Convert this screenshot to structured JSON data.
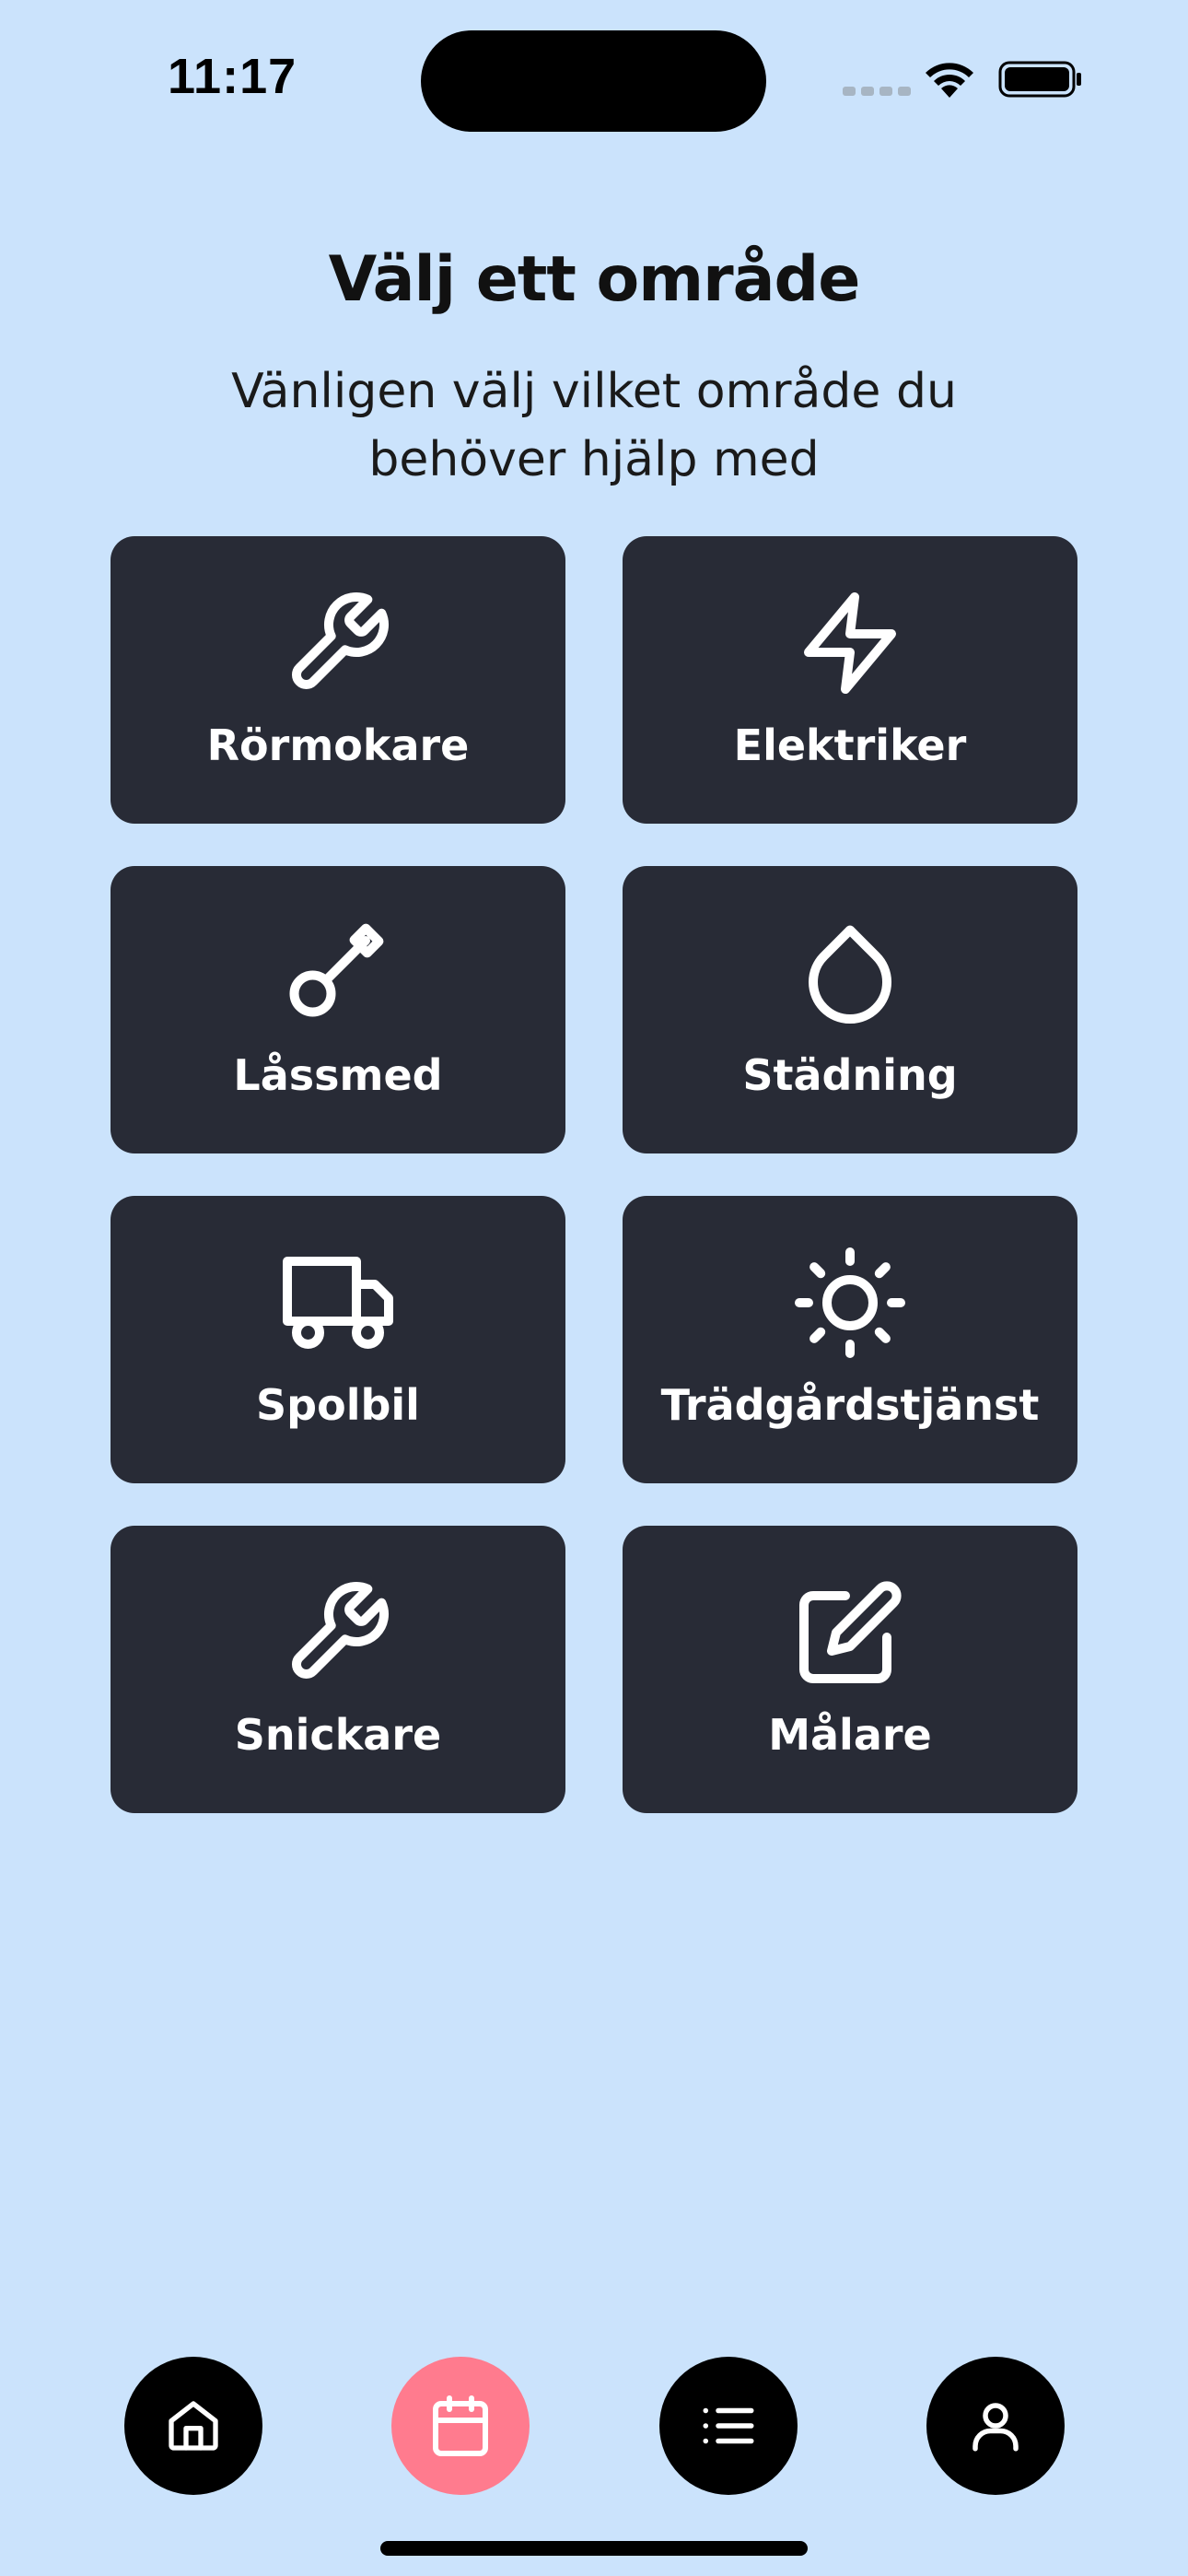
{
  "status_bar": {
    "time": "11:17"
  },
  "header": {
    "title": "Välj ett område",
    "subtitle": "Vänligen välj vilket område du behöver hjälp med"
  },
  "categories": [
    {
      "label": "Rörmokare",
      "icon": "wrench-icon"
    },
    {
      "label": "Elektriker",
      "icon": "lightning-icon"
    },
    {
      "label": "Låssmed",
      "icon": "key-icon"
    },
    {
      "label": "Städning",
      "icon": "droplet-icon"
    },
    {
      "label": "Spolbil",
      "icon": "truck-icon"
    },
    {
      "label": "Trädgårdstjänst",
      "icon": "sun-icon"
    },
    {
      "label": "Snickare",
      "icon": "wrench-icon"
    },
    {
      "label": "Målare",
      "icon": "edit-icon"
    }
  ],
  "bottom_nav": {
    "items": [
      {
        "icon": "home-icon",
        "active": false
      },
      {
        "icon": "calendar-icon",
        "active": true
      },
      {
        "icon": "list-icon",
        "active": false
      },
      {
        "icon": "user-icon",
        "active": false
      }
    ]
  },
  "colors": {
    "background": "#cbe3fc",
    "card": "#282b36",
    "accent": "#ff7b8e"
  }
}
